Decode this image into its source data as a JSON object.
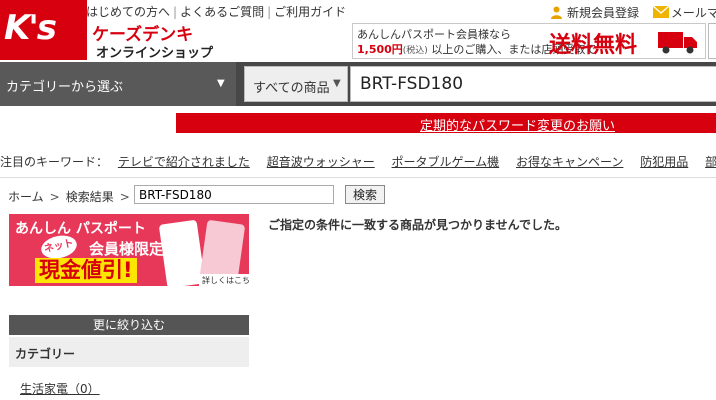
{
  "header": {
    "logo_text": "K's",
    "brand_name": "ケーズデンキ",
    "brand_sub": "オンラインショップ",
    "top_links": [
      "はじめての方へ",
      "よくあるご質問",
      "ご利用ガイド"
    ],
    "register_label": "新規会員登録",
    "mail_label": "メールマ"
  },
  "banner": {
    "line1": "あんしんパスポート会員様なら",
    "amount": "1,500円",
    "tax": "(税込)",
    "line2_rest": "以上のご購入、または店頭受取で",
    "headline": "送料無料"
  },
  "search": {
    "category_label": "カテゴリーから選ぶ",
    "scope_label": "すべての商品",
    "query": "BRT-FSD180"
  },
  "notice": {
    "password_link": "定期的なパスワード変更のお願い"
  },
  "keywords": {
    "label": "注目のキーワード：",
    "items": [
      "テレビで紹介されました",
      "超音波ウォッシャー",
      "ポータブルゲーム機",
      "お得なキャンペーン",
      "防犯用品",
      "部屋"
    ]
  },
  "breadcrumb": {
    "home": "ホーム",
    "results": "検索結果",
    "query": "BRT-FSD180",
    "search_button": "検索"
  },
  "promo": {
    "title": "あんしん パスポート",
    "net_badge": "ネットでも",
    "members": "会員様限定",
    "discount": "現金値引!",
    "more": "詳しくはこちら>>"
  },
  "result": {
    "message": "ご指定の条件に一致する商品が見つかりませんでした。"
  },
  "refine": {
    "heading": "更に絞り込む",
    "category_heading": "カテゴリー",
    "items": [
      "生活家電（0）"
    ]
  },
  "colors": {
    "brand_red": "#d7000f",
    "search_bar": "#474747",
    "promo_pink": "#e8385a"
  }
}
